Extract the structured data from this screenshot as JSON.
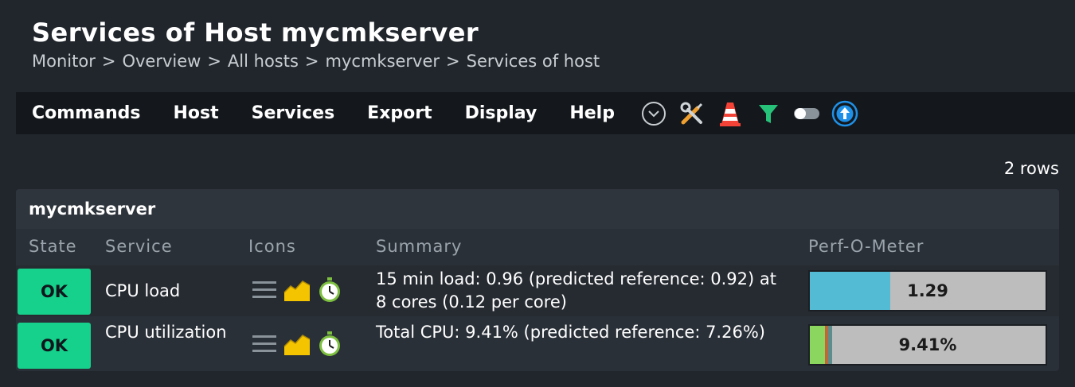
{
  "page": {
    "title": "Services of Host mycmkserver",
    "breadcrumb": [
      "Monitor",
      "Overview",
      "All hosts",
      "mycmkserver",
      "Services of host"
    ],
    "breadcrumb_sep": ">"
  },
  "menubar": {
    "items": [
      "Commands",
      "Host",
      "Services",
      "Export",
      "Display",
      "Help"
    ],
    "icons": [
      "chevron-down-circle-icon",
      "wrench-screwdriver-icon",
      "traffic-cone-icon",
      "filter-icon",
      "toggle-icon",
      "upload-arrow-icon"
    ]
  },
  "rowcount": "2 rows",
  "table": {
    "group": "mycmkserver",
    "columns": [
      "State",
      "Service",
      "Icons",
      "Summary",
      "Perf-O-Meter"
    ],
    "rows": [
      {
        "state": "OK",
        "service": "CPU load",
        "icons": [
          "menu-lines-icon",
          "graph-icon",
          "stopwatch-icon"
        ],
        "summary": "15 min load: 0.96 (predicted reference: 0.92) at 8 cores (0.12 per core)",
        "perf_label": "1.29",
        "perf_fraction": 0.34,
        "perf_color": "#53bcd4"
      },
      {
        "state": "OK",
        "service": "CPU utilization",
        "icons": [
          "menu-lines-icon",
          "graph-icon",
          "stopwatch-icon"
        ],
        "summary": "Total CPU: 9.41% (predicted reference: 7.26%)",
        "perf_label": "9.41%",
        "perf_fraction": 0.0941,
        "perf_color": "#8ad65e"
      }
    ]
  },
  "colors": {
    "ok": "#15d18b",
    "background": "#21262d",
    "menubar": "#14181c",
    "accent_blue": "#1e90e8"
  }
}
